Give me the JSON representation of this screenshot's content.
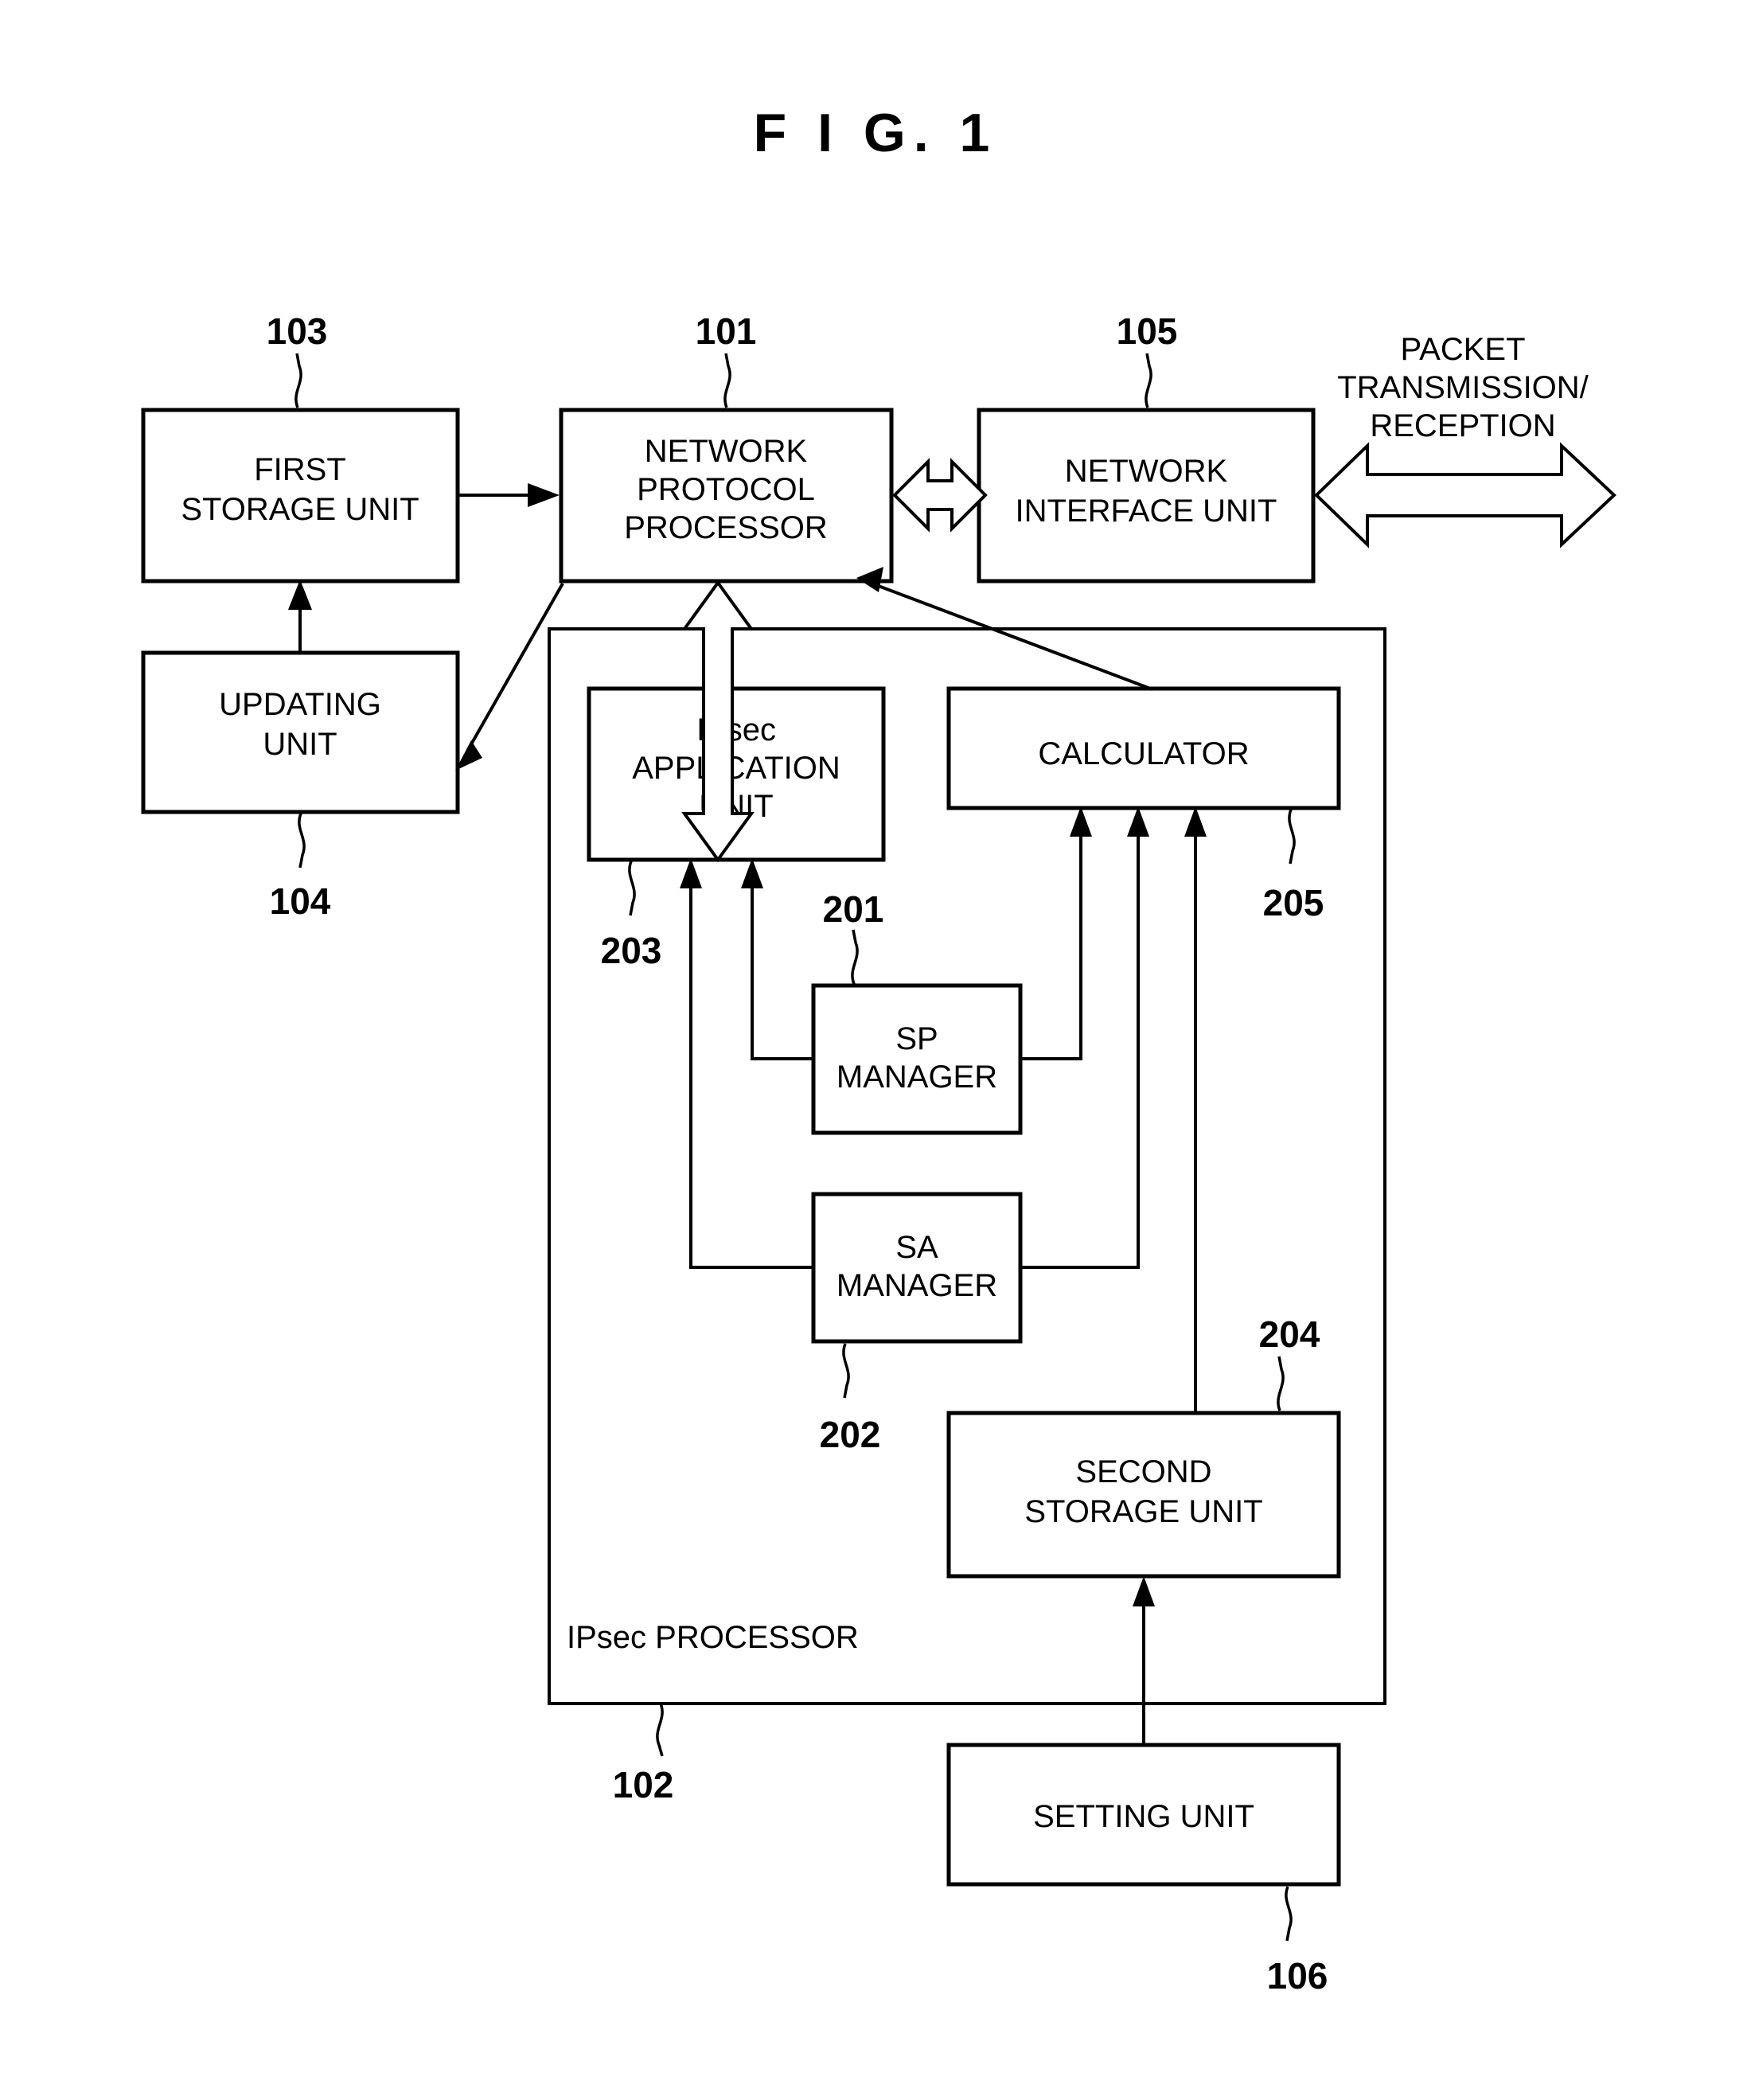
{
  "figure": {
    "title": "F I G. 1"
  },
  "blocks": {
    "first_storage_unit": {
      "line1": "FIRST",
      "line2": "STORAGE UNIT",
      "ref": "103"
    },
    "updating_unit": {
      "line1": "UPDATING",
      "line2": "UNIT",
      "ref": "104"
    },
    "network_protocol_processor": {
      "line1": "NETWORK",
      "line2": "PROTOCOL",
      "line3": "PROCESSOR",
      "ref": "101"
    },
    "network_interface_unit": {
      "line1": "NETWORK",
      "line2": "INTERFACE UNIT",
      "ref": "105"
    },
    "ipsec_application_unit": {
      "line1": "IPsec",
      "line2": "APPLICATION",
      "line3": "UNIT",
      "ref": "203"
    },
    "calculator": {
      "line1": "CALCULATOR",
      "ref": "205"
    },
    "sp_manager": {
      "line1": "SP",
      "line2": "MANAGER",
      "ref": "201"
    },
    "sa_manager": {
      "line1": "SA",
      "line2": "MANAGER",
      "ref": "202"
    },
    "second_storage_unit": {
      "line1": "SECOND",
      "line2": "STORAGE UNIT",
      "ref": "204"
    },
    "setting_unit": {
      "line1": "SETTING UNIT",
      "ref": "106"
    },
    "ipsec_processor": {
      "label": "IPsec PROCESSOR",
      "ref": "102"
    }
  },
  "annotations": {
    "packet_flow": {
      "line1": "PACKET",
      "line2": "TRANSMISSION/",
      "line3": "RECEPTION"
    }
  },
  "colors": {
    "ink": "#000000",
    "paper": "#ffffff"
  }
}
